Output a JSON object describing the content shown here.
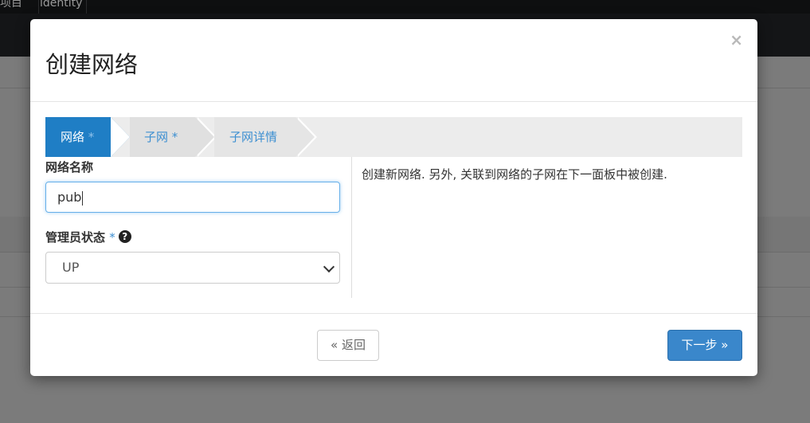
{
  "background": {
    "tabs": [
      "项目",
      "identity"
    ]
  },
  "modal": {
    "title": "创建网络",
    "close_label": "×"
  },
  "wizard": {
    "steps": [
      {
        "label": "网络",
        "required_mark": "*",
        "active": true
      },
      {
        "label": "子网",
        "required_mark": "*",
        "active": false
      },
      {
        "label": "子网详情",
        "required_mark": "",
        "active": false
      }
    ]
  },
  "form": {
    "network_name_label": "网络名称",
    "network_name_value": "pub",
    "admin_state_label": "管理员状态",
    "admin_state_required": "*",
    "help_glyph": "?",
    "admin_state_value": "UP",
    "description": "创建新网络. 另外, 关联到网络的子网在下一面板中被创建."
  },
  "footer": {
    "back_label": "« 返回",
    "next_label": "下一步 »"
  },
  "colors": {
    "accent": "#1f7ec5",
    "link": "#3d8fd1",
    "primary_button": "#3a87cb"
  }
}
